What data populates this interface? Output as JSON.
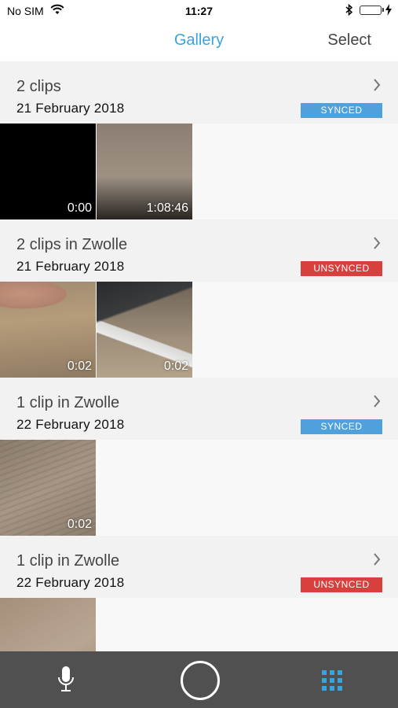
{
  "status_bar": {
    "carrier": "No SIM",
    "time": "11:27",
    "wifi_icon": "wifi-icon",
    "bluetooth_icon": "bluetooth-icon",
    "battery_level": 1.0
  },
  "nav": {
    "title": "Gallery",
    "select_label": "Select",
    "title_color": "#3ba3dc"
  },
  "sections": [
    {
      "title": "2 clips",
      "date": "21 February 2018",
      "status": "SYNCED",
      "clips": [
        {
          "duration": "0:00"
        },
        {
          "duration": "1:08:46"
        }
      ]
    },
    {
      "title": "2 clips in Zwolle",
      "date": "21 February 2018",
      "status": "UNSYNCED",
      "clips": [
        {
          "duration": "0:02"
        },
        {
          "duration": "0:02"
        }
      ]
    },
    {
      "title": "1 clip in Zwolle",
      "date": "22 February 2018",
      "status": "SYNCED",
      "clips": [
        {
          "duration": "0:02"
        }
      ]
    },
    {
      "title": "1 clip in Zwolle",
      "date": "22 February 2018",
      "status": "UNSYNCED",
      "clips": [
        {
          "duration": ""
        }
      ]
    }
  ],
  "tabbar": {
    "mic_icon": "microphone-icon",
    "record_icon": "record-circle-icon",
    "grid_icon": "grid-icon",
    "grid_color": "#3ba3dc"
  },
  "colors": {
    "synced": "#4fa1dc",
    "unsynced": "#d8403e",
    "tabbar_bg": "#505050"
  }
}
